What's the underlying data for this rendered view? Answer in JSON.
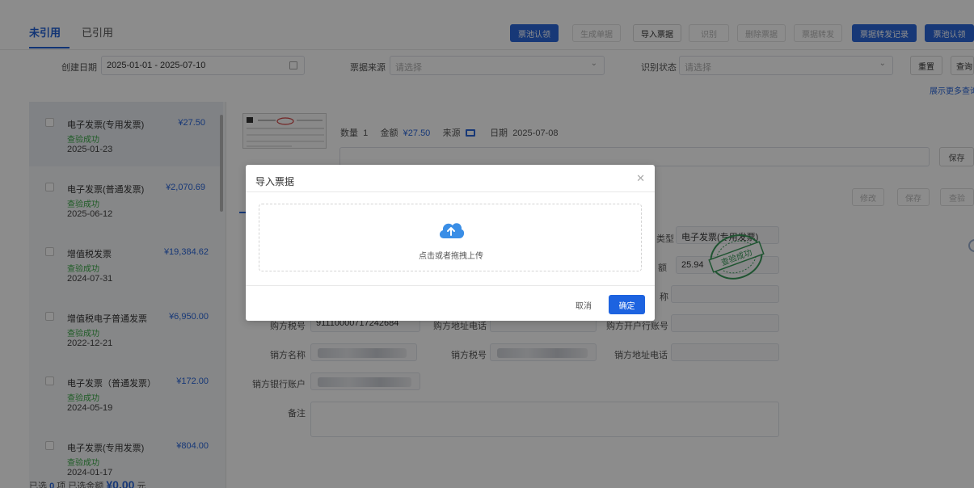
{
  "tabs": {
    "unused": "未引用",
    "used": "已引用"
  },
  "toolbar": {
    "buttons": [
      "票池认领",
      "生成单据",
      "导入票据",
      "识别",
      "删除票据",
      "票据转发",
      "票据转发记录",
      "票池认领"
    ]
  },
  "filters": {
    "create_date_label": "创建日期",
    "create_date_value": "2025-01-01 - 2025-07-10",
    "source_label": "票据来源",
    "source_placeholder": "请选择",
    "status_label": "识别状态",
    "status_placeholder": "请选择",
    "reset": "重置",
    "query": "查询",
    "more": "展示更多查询"
  },
  "invoices": [
    {
      "title": "电子发票(专用发票)",
      "amount": "¥27.50",
      "status": "查验成功",
      "date": "2025-01-23"
    },
    {
      "title": "电子发票(普通发票)",
      "amount": "¥2,070.69",
      "status": "查验成功",
      "date": "2025-06-12"
    },
    {
      "title": "增值税发票",
      "amount": "¥19,384.62",
      "status": "查验成功",
      "date": "2024-07-31"
    },
    {
      "title": "增值税电子普通发票",
      "amount": "¥6,950.00",
      "status": "查验成功",
      "date": "2022-12-21"
    },
    {
      "title": "电子发票（普通发票）",
      "amount": "¥172.00",
      "status": "查验成功",
      "date": "2024-05-19"
    },
    {
      "title": "电子发票(专用发票)",
      "amount": "¥804.00",
      "status": "查验成功",
      "date": "2024-01-17"
    }
  ],
  "footer": {
    "selected_prefix": "已选",
    "selected_count": "0",
    "selected_mid": "项 已选金额",
    "selected_amount": "¥0.00",
    "selected_suffix": "元"
  },
  "detail": {
    "count_label": "数量",
    "count_value": "1",
    "amount_label": "金额",
    "amount_value": "¥27.50",
    "source_label": "来源",
    "date_label": "日期",
    "date_value": "2025-07-08",
    "save": "保存",
    "edit": "修改",
    "save2": "保存",
    "check": "查验",
    "type_label": "类型",
    "type_value": "电子发票(专用发票)",
    "tax_label": "额",
    "tax_value": "25.94",
    "name_label": "称",
    "buyer_tax_label": "购方税号",
    "buyer_tax_value": "91110000717242684",
    "buyer_addr_label": "购方地址电话",
    "buyer_bank_label": "购方开户行账号",
    "seller_name_label": "销方名称",
    "seller_tax_label": "销方税号",
    "seller_addr_label": "销方地址电话",
    "seller_bank_label": "销方银行账户",
    "note_label": "备注",
    "stamp_text": "查验成功"
  },
  "modal": {
    "title": "导入票据",
    "upload_text": "点击或者拖拽上传",
    "cancel": "取消",
    "ok": "确定"
  },
  "colors": {
    "primary": "#2a66d9",
    "success": "#39a845",
    "stamp": "#3a9a5a"
  }
}
